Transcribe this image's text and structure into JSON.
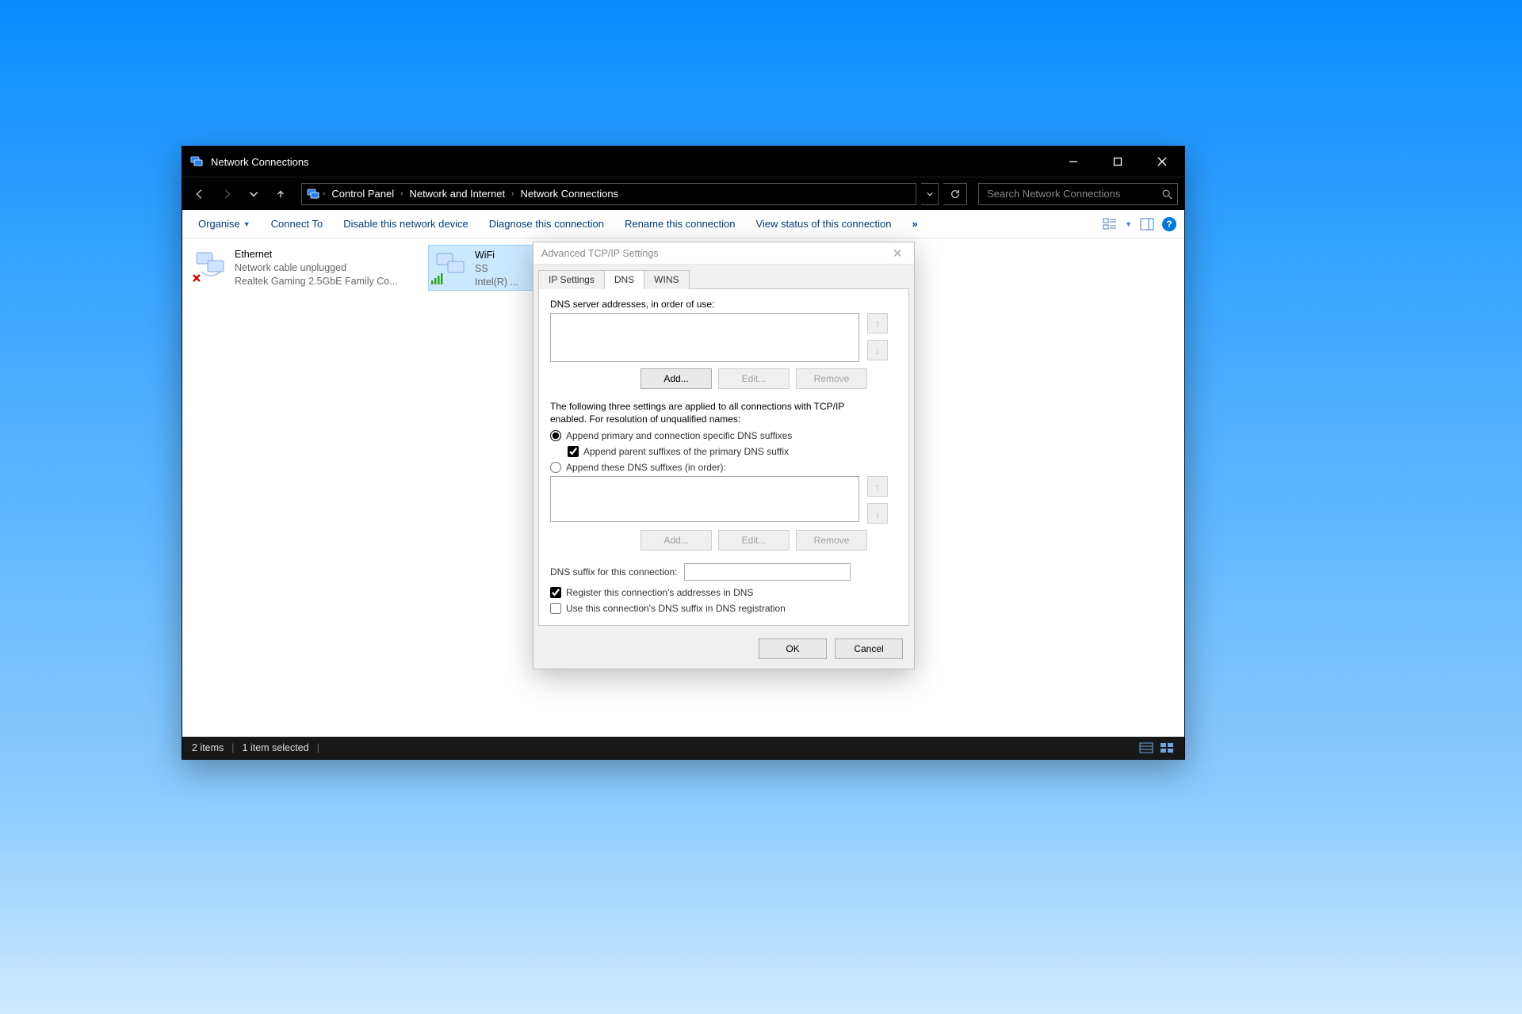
{
  "window": {
    "title": "Network Connections"
  },
  "breadcrumb": {
    "items": [
      "Control Panel",
      "Network and Internet",
      "Network Connections"
    ]
  },
  "search": {
    "placeholder": "Search Network Connections"
  },
  "commands": {
    "organise": "Organise",
    "connect_to": "Connect To",
    "disable": "Disable this network device",
    "diagnose": "Diagnose this connection",
    "rename": "Rename this connection",
    "view_status": "View status of this connection",
    "more": "»"
  },
  "adapters": {
    "ethernet": {
      "name": "Ethernet",
      "status": "Network cable unplugged",
      "device": "Realtek Gaming 2.5GbE Family Co..."
    },
    "wifi": {
      "name": "WiFi",
      "status": "SS",
      "device": "Intel(R) ..."
    }
  },
  "statusbar": {
    "items_count": "2 items",
    "selected": "1 item selected"
  },
  "dialog": {
    "title": "Advanced TCP/IP Settings",
    "tabs": {
      "ip": "IP Settings",
      "dns": "DNS",
      "wins": "WINS"
    },
    "dns": {
      "servers_label": "DNS server addresses, in order of use:",
      "add": "Add...",
      "edit": "Edit...",
      "remove": "Remove",
      "paragraph": "The following three settings are applied to all connections with TCP/IP enabled. For resolution of unqualified names:",
      "radio1": "Append primary and connection specific DNS suffixes",
      "radio1_sub": "Append parent suffixes of the primary DNS suffix",
      "radio2": "Append these DNS suffixes (in order):",
      "suffix_label": "DNS suffix for this connection:",
      "check_register": "Register this connection's addresses in DNS",
      "check_use_suffix": "Use this connection's DNS suffix in DNS registration"
    },
    "ok": "OK",
    "cancel": "Cancel"
  }
}
